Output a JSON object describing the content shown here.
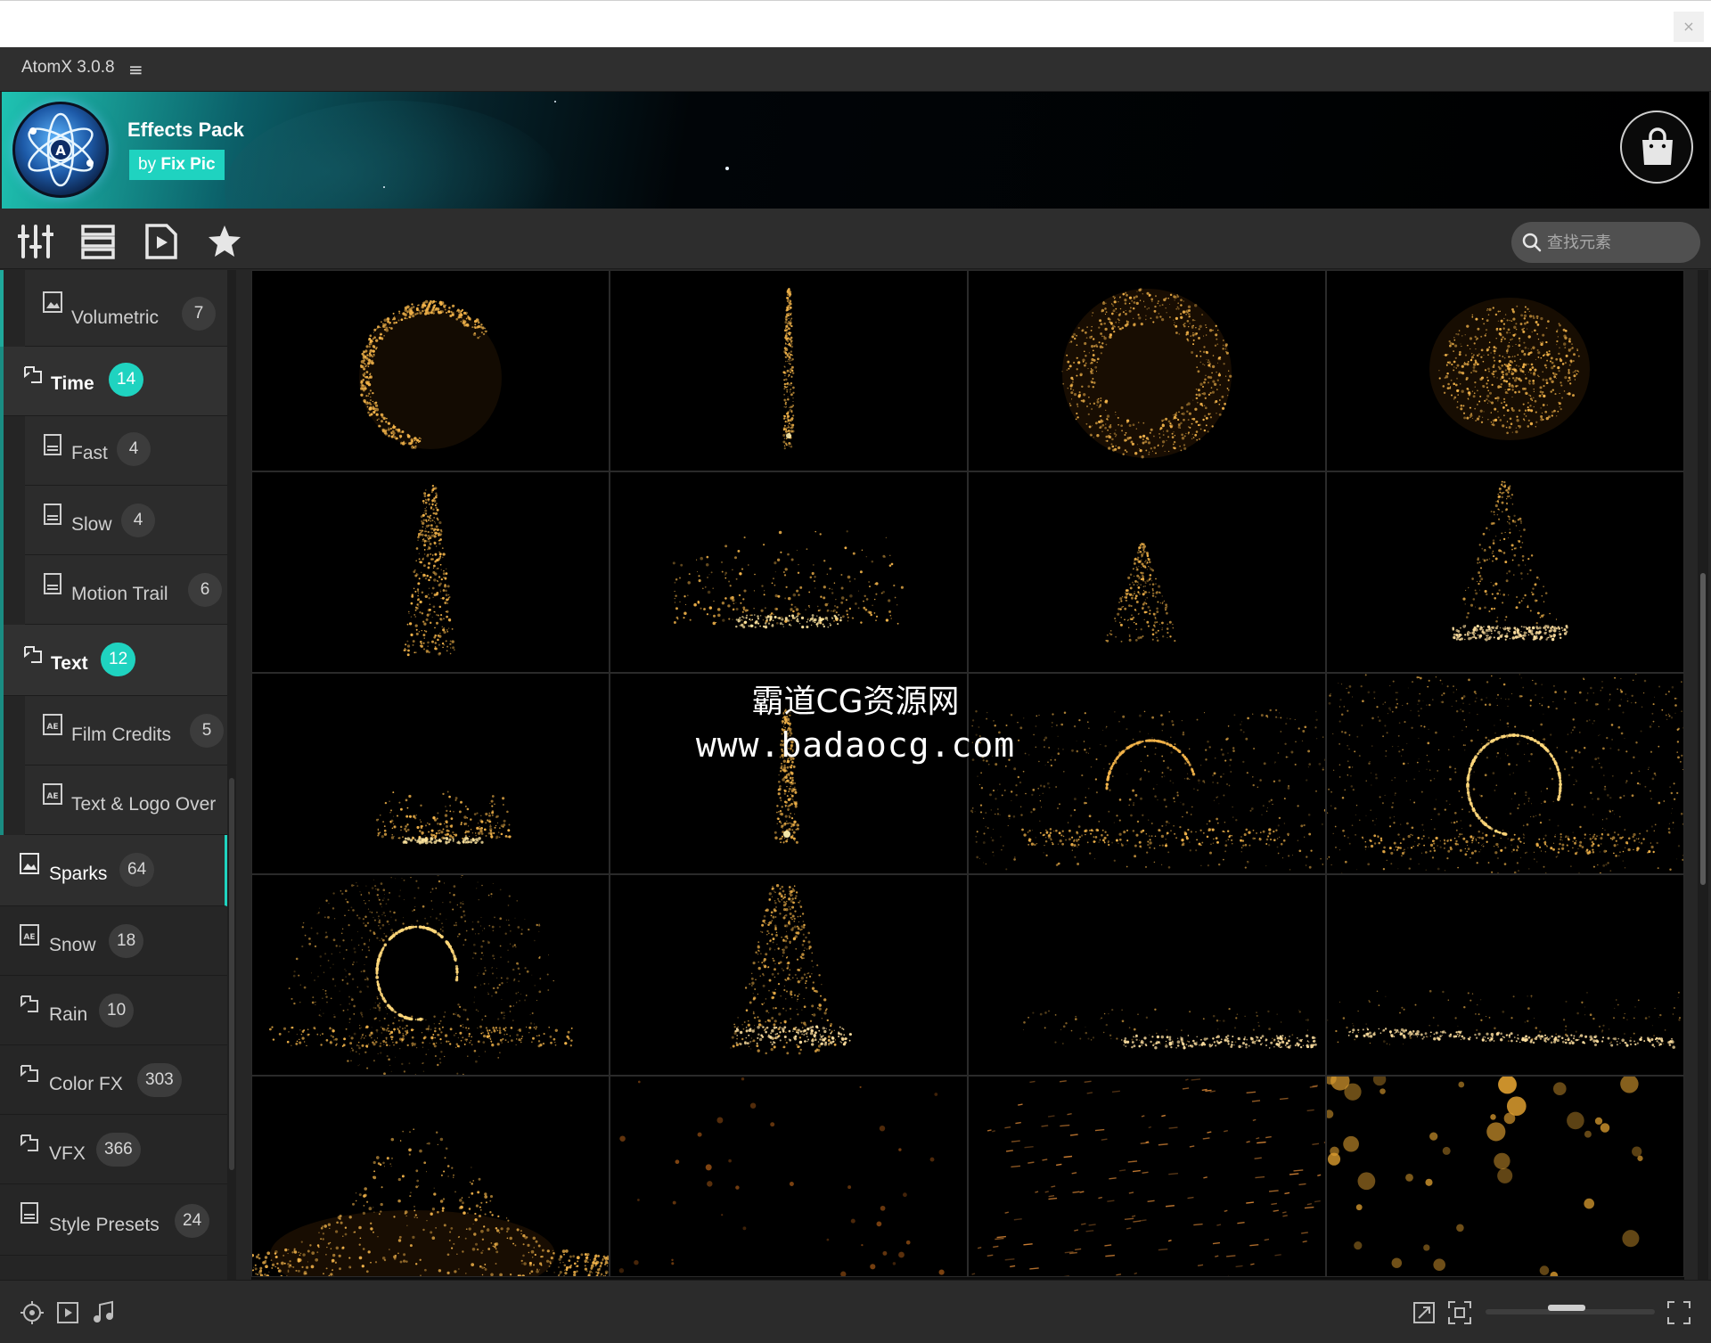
{
  "app": {
    "title": "AtomX 3.0.8"
  },
  "banner": {
    "pack_title": "Effects Pack",
    "by_prefix": "by",
    "by_name": "Fix Pic"
  },
  "search": {
    "placeholder": "查找元素"
  },
  "sidebar": {
    "rows": [
      {
        "label": "Volumetric",
        "count": "7",
        "icon": "image-icon",
        "level": "sub"
      },
      {
        "label": "Time",
        "count": "14",
        "icon": "folder-icon",
        "level": "group"
      },
      {
        "label": "Fast",
        "count": "4",
        "icon": "document-icon",
        "level": "sub"
      },
      {
        "label": "Slow",
        "count": "4",
        "icon": "document-icon",
        "level": "sub"
      },
      {
        "label": "Motion Trail",
        "count": "6",
        "icon": "document-icon",
        "level": "sub"
      },
      {
        "label": "Text",
        "count": "12",
        "icon": "folder-icon",
        "level": "group"
      },
      {
        "label": "Film Credits",
        "count": "5",
        "icon": "ae-file-icon",
        "level": "sub"
      },
      {
        "label": "Text & Logo Over",
        "count": "",
        "icon": "ae-file-icon",
        "level": "sub"
      },
      {
        "label": "Sparks",
        "count": "64",
        "icon": "image-icon",
        "level": "top",
        "selected": true
      },
      {
        "label": "Snow",
        "count": "18",
        "icon": "ae-file-icon",
        "level": "top"
      },
      {
        "label": "Rain",
        "count": "10",
        "icon": "folder-icon",
        "level": "top"
      },
      {
        "label": "Color FX",
        "count": "303",
        "icon": "folder-icon",
        "level": "top"
      },
      {
        "label": "VFX",
        "count": "366",
        "icon": "folder-icon",
        "level": "top"
      },
      {
        "label": "Style Presets",
        "count": "24",
        "icon": "document-icon",
        "level": "top"
      }
    ]
  },
  "watermark": {
    "line1": "霸道CG资源网",
    "line2": "www.badaocg.com"
  },
  "colors": {
    "accent": "#1fd3c0",
    "background": "#262626",
    "spark": "#f3b44a"
  },
  "grid": {
    "thumbnails": [
      "spark-crescent",
      "spark-fountain-thin",
      "spark-ring",
      "spark-burst",
      "spark-column",
      "spark-ground-scatter",
      "spark-fountain-low",
      "spark-splash",
      "spark-ground-small",
      "spark-jet",
      "spark-swirl-arc",
      "spark-swirl-ring",
      "spark-ring-wide",
      "spark-burst-tall",
      "spark-ground-streak",
      "spark-ground-streak-long",
      "spark-mound",
      "embers-sparse",
      "embers-streaks",
      "bokeh-embers"
    ]
  }
}
